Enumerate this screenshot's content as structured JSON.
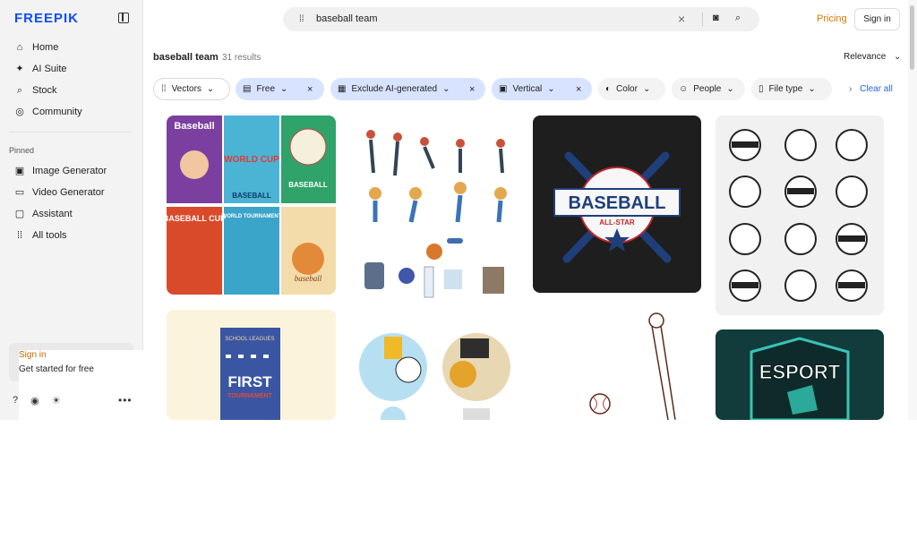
{
  "app": {
    "logo": "FREEPIK"
  },
  "sidebar": {
    "main": [
      {
        "label": "Home",
        "icon": "home-icon"
      },
      {
        "label": "AI Suite",
        "icon": "sparkle-icon"
      },
      {
        "label": "Stock",
        "icon": "search-icon"
      },
      {
        "label": "Community",
        "icon": "globe-icon"
      }
    ],
    "pinned_label": "Pinned",
    "pinned": [
      {
        "label": "Image Generator",
        "icon": "image-icon"
      },
      {
        "label": "Video Generator",
        "icon": "video-icon"
      },
      {
        "label": "Assistant",
        "icon": "chat-icon"
      },
      {
        "label": "All tools",
        "icon": "grid-icon"
      }
    ],
    "signin_card": {
      "title": "Sign in",
      "subtitle": "Get started for free"
    }
  },
  "header": {
    "search_value": "baseball team",
    "pricing": "Pricing",
    "signin": "Sign in"
  },
  "results": {
    "title": "baseball team",
    "count": "31 results",
    "sort": "Relevance"
  },
  "filters": {
    "vectors": "Vectors",
    "free": "Free",
    "exclude_ai": "Exclude AI-generated",
    "vertical": "Vertical",
    "color": "Color",
    "people": "People",
    "file_type": "File type",
    "clear_all": "Clear all"
  },
  "tiles": {
    "poster_baseball": "Baseball",
    "poster_world_cup": "WORLD CUP",
    "poster_baseball2": "BASEBALL",
    "poster_cup": "BASEBALL CUP",
    "poster_world_tournament": "WORLD TOURNAMENT",
    "poster_baseball3": "baseball",
    "logo_baseball": "BASEBALL",
    "logo_allstar": "ALL-STAR",
    "tournament_school": "SCHOOL LEAGUES",
    "tournament_first": "FIRST",
    "tournament_sub": "TOURNAMENT",
    "esport": "ESPORT"
  },
  "colors": {
    "accent_blue": "#2563eb",
    "chip_active": "#d8e3ff",
    "pricing": "#d47b00"
  }
}
